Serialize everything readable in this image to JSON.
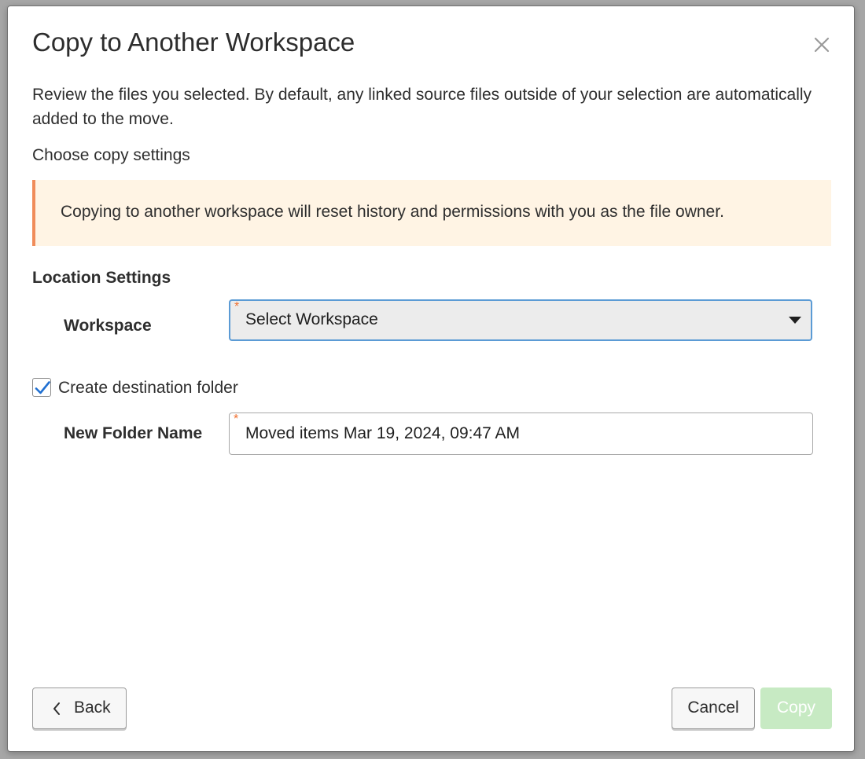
{
  "dialog": {
    "title": "Copy to Another Workspace",
    "intro": "Review the files you selected. By default, any linked source files outside of your selection are automatically added to the move.",
    "subheading": "Choose copy settings",
    "warning": "Copying to another workspace will reset history and permissions with you as the file owner.",
    "location_settings": {
      "heading": "Location Settings",
      "workspace_label": "Workspace",
      "workspace_select": {
        "value": "Select Workspace",
        "required_mark": "*"
      }
    },
    "create_folder": {
      "label": "Create destination folder",
      "checked": true
    },
    "new_folder": {
      "label": "New Folder Name",
      "value": "Moved items Mar 19, 2024, 09:47 AM",
      "required_mark": "*"
    },
    "buttons": {
      "back": "Back",
      "cancel": "Cancel",
      "copy": "Copy"
    }
  },
  "icons": {
    "close": "close-icon",
    "caret": "caret-down-icon",
    "check": "checkmark-icon",
    "back": "chevron-left-icon"
  },
  "colors": {
    "warning_background": "#fff4e4",
    "warning_accent": "#f08c5a",
    "focus_border": "#5b9bd5",
    "checkmark": "#1f6fd1",
    "copy_button_disabled": "#c7eac3",
    "required_mark": "#f07030"
  }
}
